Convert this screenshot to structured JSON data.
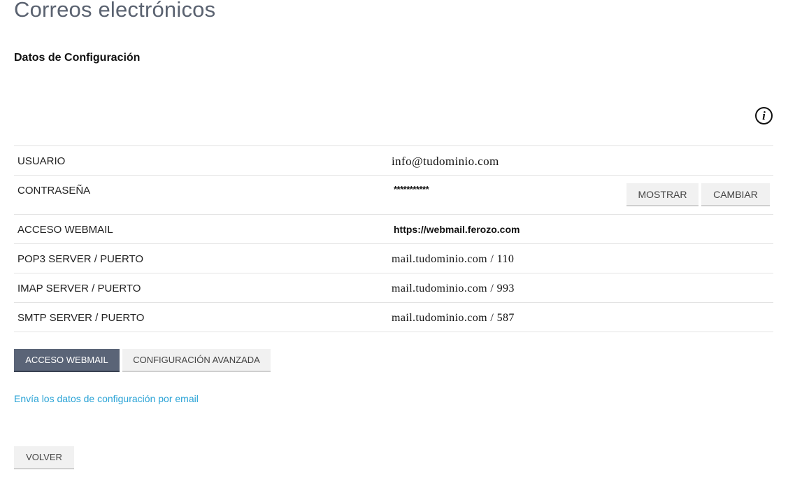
{
  "page": {
    "title": "Correos electrónicos",
    "section_title": "Datos de Configuración"
  },
  "info_icon": {
    "glyph": "i",
    "icon": "info-icon"
  },
  "config": {
    "usuario": {
      "label": "USUARIO",
      "value": "info@tudominio.com"
    },
    "contrasena": {
      "label": "CONTRASEÑA",
      "value": "***********",
      "show_label": "MOSTRAR",
      "change_label": "CAMBIAR"
    },
    "webmail": {
      "label": "ACCESO WEBMAIL",
      "value": "https://webmail.ferozo.com"
    },
    "pop3": {
      "label": "POP3 SERVER / PUERTO",
      "value": "mail.tudominio.com / 110"
    },
    "imap": {
      "label": "IMAP SERVER / PUERTO",
      "value": "mail.tudominio.com / 993"
    },
    "smtp": {
      "label": "SMTP SERVER / PUERTO",
      "value": "mail.tudominio.com / 587"
    }
  },
  "actions": {
    "webmail_label": "ACCESO WEBMAIL",
    "advanced_label": "CONFIGURACIÓN AVANZADA",
    "email_link": "Envía los datos de configuración por email",
    "back_label": "VOLVER"
  },
  "colors": {
    "primary_button": "#5a6477",
    "link": "#2aa3d6",
    "title": "#5a6270"
  }
}
